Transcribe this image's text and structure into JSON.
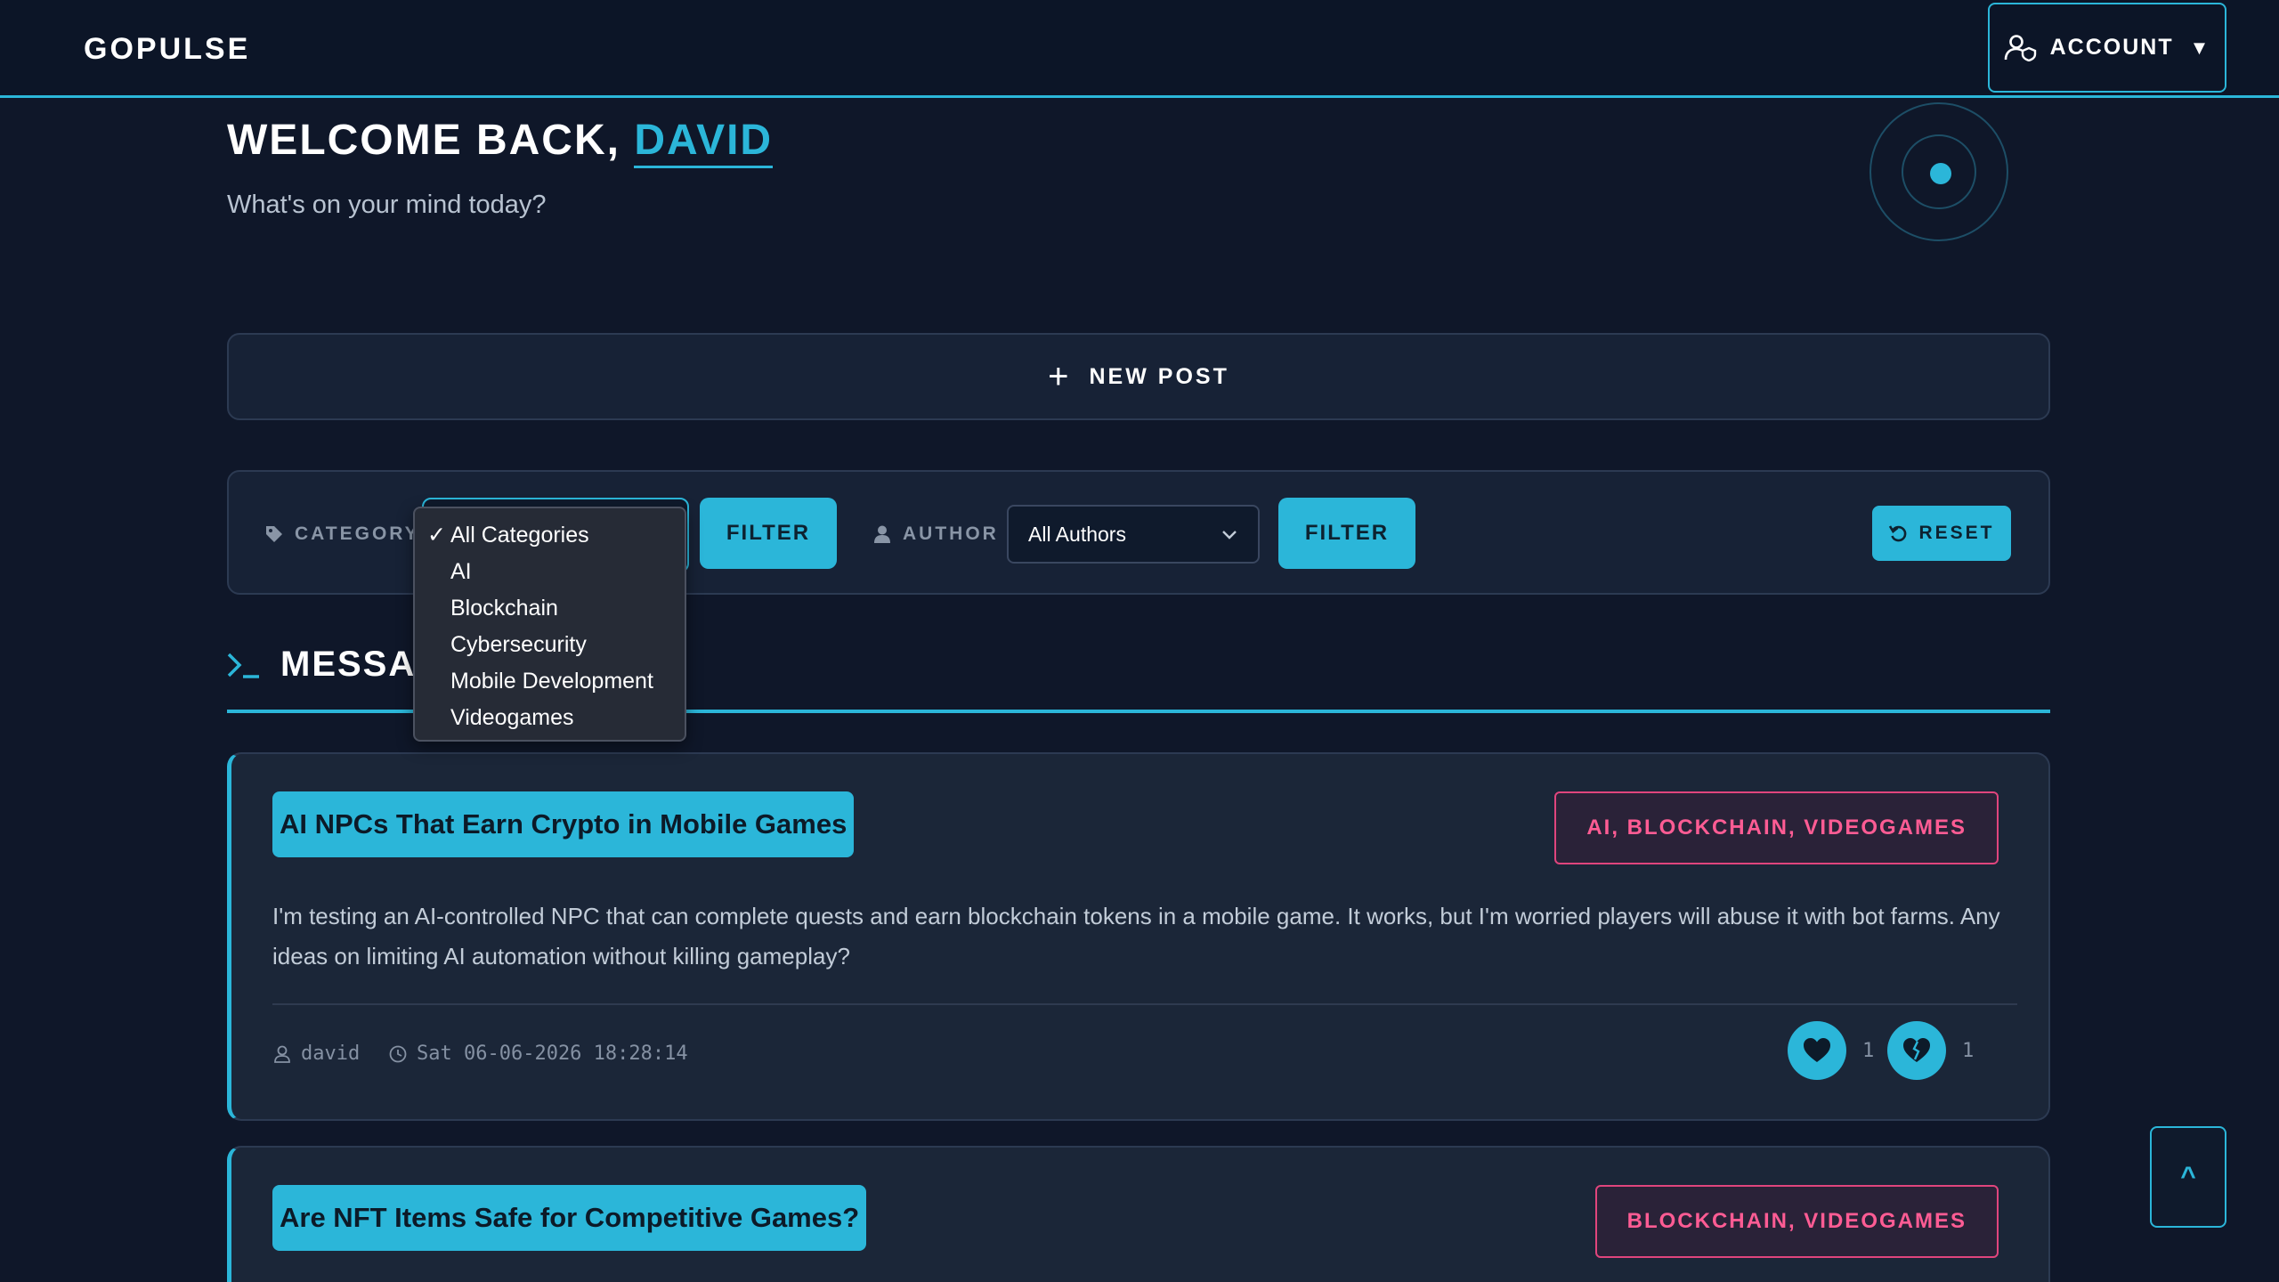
{
  "header": {
    "brand": "GOPULSE",
    "account_label": "ACCOUNT",
    "account_icon": "user-shield-icon",
    "caret": "▼"
  },
  "welcome": {
    "prefix": "WELCOME BACK, ",
    "username": "DAVID",
    "subtitle": "What's on your mind today?"
  },
  "new_post": {
    "label": "NEW POST",
    "icon": "+"
  },
  "filters": {
    "category_label": "CATEGORY",
    "category_options": [
      "All Categories",
      "AI",
      "Blockchain",
      "Cybersecurity",
      "Mobile Development",
      "Videogames"
    ],
    "category_selected": "All Categories",
    "filter_label": "FILTER",
    "author_label": "AUTHOR",
    "author_selected": "All Authors",
    "reset_label": "RESET"
  },
  "messages": {
    "heading": "MESSAG"
  },
  "posts": [
    {
      "title": "AI NPCs That Earn Crypto in Mobile Games",
      "tags": "AI, BLOCKCHAIN, VIDEOGAMES",
      "body": "I'm testing an AI-controlled NPC that can complete quests and earn blockchain tokens in a mobile game. It works, but I'm worried players will abuse it with bot farms. Any ideas on limiting AI automation without killing gameplay?",
      "author": "david",
      "timestamp": "Sat 06-06-2026 18:28:14",
      "likes": "1",
      "dislikes": "1"
    },
    {
      "title": "Are NFT Items Safe for Competitive Games?",
      "tags": "BLOCKCHAIN, VIDEOGAMES"
    }
  ],
  "scroll_top": "^",
  "colors": {
    "accent": "#2bb6d9",
    "tag": "#ff5c94",
    "background": "#0f1729"
  }
}
